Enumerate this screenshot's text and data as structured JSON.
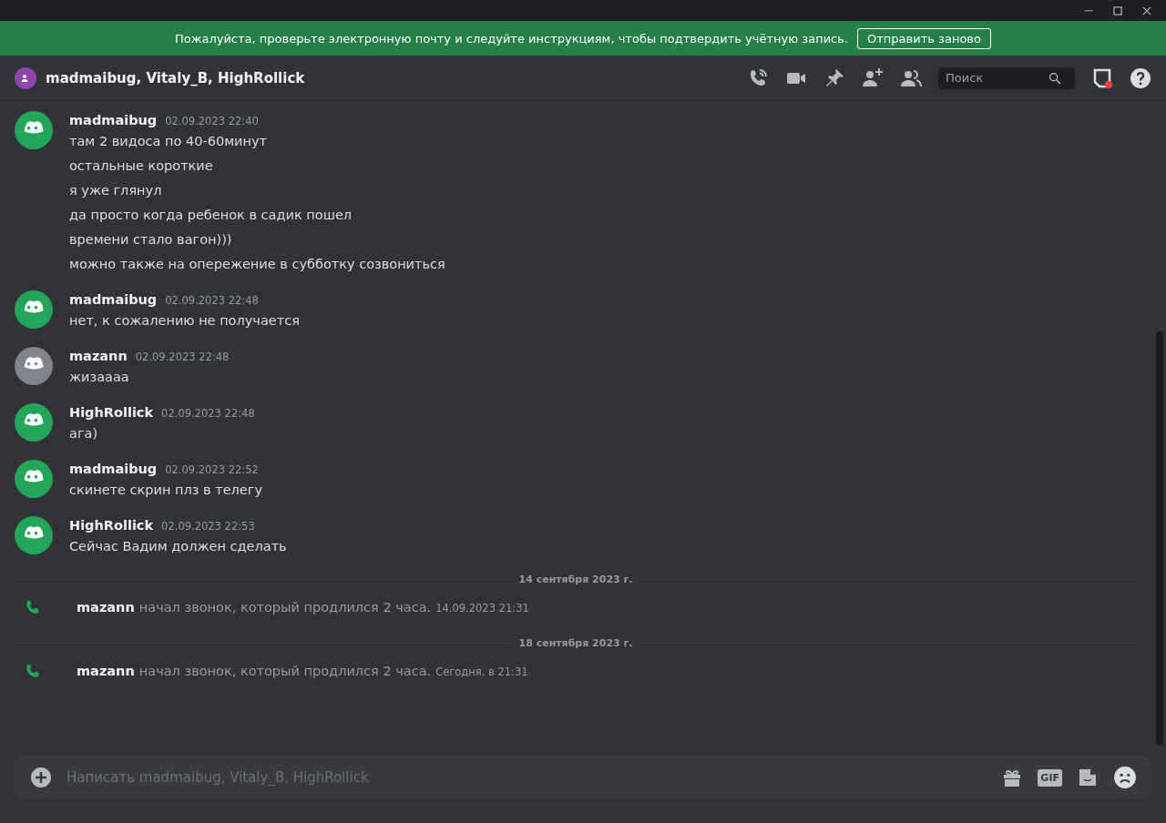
{
  "banner": {
    "text": "Пожалуйста, проверьте электронную почту и следуйте инструкциям, чтобы подтвердить учётную запись.",
    "button": "Отправить заново"
  },
  "header": {
    "title": "madmaibug, Vitaly_B, HighRollick",
    "search": {
      "placeholder": "Поиск"
    }
  },
  "feed": [
    {
      "kind": "message",
      "author": "madmaibug",
      "time": "02.09.2023 22:40",
      "color": "#23a55a",
      "lines": [
        "там 2 видоса по 40-60минут",
        "остальные короткие",
        "я уже глянул",
        "да просто когда ребенок в садик пошел",
        "времени стало вагон)))",
        "можно также на опережение в субботку созвониться"
      ]
    },
    {
      "kind": "message",
      "author": "madmaibug",
      "time": "02.09.2023 22:48",
      "color": "#23a55a",
      "lines": [
        "нет, к сожалению не получается"
      ]
    },
    {
      "kind": "message",
      "author": "mazann",
      "time": "02.09.2023 22:48",
      "color": "#80848e",
      "lines": [
        "жизаааа"
      ]
    },
    {
      "kind": "message",
      "author": "HighRollick",
      "time": "02.09.2023 22:48",
      "color": "#23a55a",
      "lines": [
        "ага)"
      ]
    },
    {
      "kind": "message",
      "author": "madmaibug",
      "time": "02.09.2023 22:52",
      "color": "#23a55a",
      "lines": [
        "скинете скрин плз в телегу"
      ]
    },
    {
      "kind": "message",
      "author": "HighRollick",
      "time": "02.09.2023 22:53",
      "color": "#23a55a",
      "lines": [
        "Сейчас Вадим должен сделать"
      ]
    },
    {
      "kind": "divider",
      "label": "14 сентября 2023 г."
    },
    {
      "kind": "call",
      "author": "mazann",
      "text": "начал звонок, который продлился 2 часа.",
      "time": "14.09.2023 21:31"
    },
    {
      "kind": "divider",
      "label": "18 сентября 2023 г."
    },
    {
      "kind": "call",
      "author": "mazann",
      "text": "начал звонок, который продлился 2 часа.",
      "time": "Сегодня, в 21:31"
    }
  ],
  "composer": {
    "placeholder": "Написать madmaibug, Vitaly_B, HighRollick",
    "gif_label": "GIF"
  }
}
